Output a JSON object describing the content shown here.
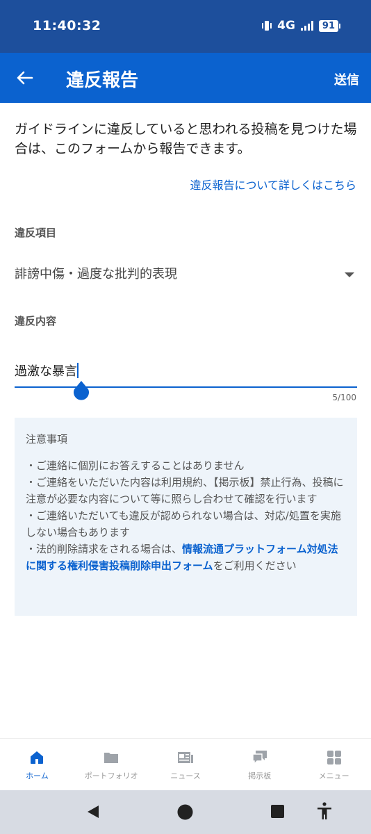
{
  "status_bar": {
    "time": "11:40:32",
    "network": "4G",
    "battery": "91",
    "icons": [
      "vibrate-icon",
      "signal-icon",
      "battery-icon"
    ]
  },
  "app_bar": {
    "title": "違反報告",
    "send_label": "送信",
    "back_icon": "arrow-left-icon"
  },
  "intro": {
    "text": "ガイドラインに違反していると思われる投稿を見つけた場合は、このフォームから報告できます。",
    "link": "違反報告について詳しくはこちら"
  },
  "form": {
    "violation_item": {
      "label": "違反項目",
      "selected": "誹謗中傷・過度な批判的表現"
    },
    "violation_content": {
      "label": "違反内容",
      "value": "過激な暴言",
      "counter": "5/100"
    }
  },
  "notice": {
    "title": "注意事項",
    "line1": "・ご連絡に個別にお答えすることはありません",
    "line2": "・ご連絡をいただいた内容は利用規約、【掲示板】禁止行為、投稿に注意が必要な内容について等に照らし合わせて確認を行います",
    "line3": "・ご連絡いただいても違反が認められない場合は、対応/処置を実施しない場合もあります",
    "line4_prefix": "・法的削除請求をされる場合は、",
    "line4_link": "情報流通プラットフォーム対処法に関する権利侵害投稿削除申出フォーム",
    "line4_suffix": "をご利用ください"
  },
  "bottom_nav": {
    "items": [
      {
        "label": "ホーム",
        "icon": "home-icon",
        "active": true
      },
      {
        "label": "ポートフォリオ",
        "icon": "folder-icon",
        "active": false
      },
      {
        "label": "ニュース",
        "icon": "news-icon",
        "active": false
      },
      {
        "label": "掲示板",
        "icon": "chat-icon",
        "active": false
      },
      {
        "label": "メニュー",
        "icon": "grid-icon",
        "active": false
      }
    ]
  },
  "colors": {
    "status_bar": "#1d4f9c",
    "app_bar": "#0b62cf",
    "accent": "#0b62cf",
    "notice_bg": "#eef4fa"
  }
}
